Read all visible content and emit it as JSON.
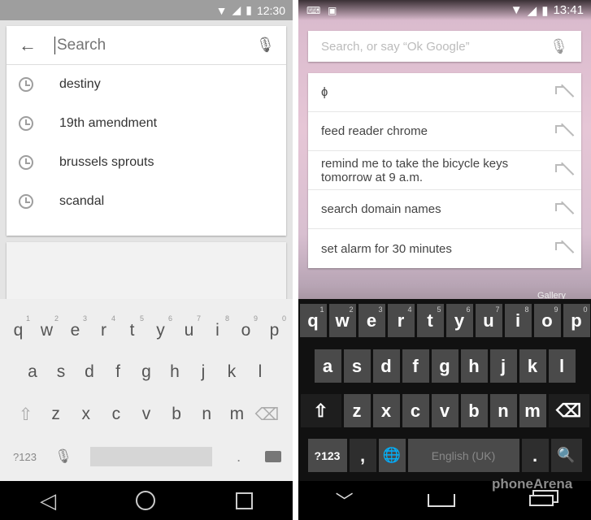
{
  "left": {
    "status_time": "12:30",
    "search_placeholder": "Search",
    "history": [
      "destiny",
      "19th amendment",
      "brussels sprouts",
      "scandal"
    ],
    "keyboard": {
      "row1": [
        "q",
        "w",
        "e",
        "r",
        "t",
        "y",
        "u",
        "i",
        "o",
        "p"
      ],
      "row1_hints": [
        "1",
        "2",
        "3",
        "4",
        "5",
        "6",
        "7",
        "8",
        "9",
        "0"
      ],
      "row2": [
        "a",
        "s",
        "d",
        "f",
        "g",
        "h",
        "j",
        "k",
        "l"
      ],
      "row3": [
        "z",
        "x",
        "c",
        "v",
        "b",
        "n",
        "m"
      ],
      "symbols": "?123",
      "period": "."
    }
  },
  "right": {
    "status_time": "13:41",
    "search_placeholder": "Search, or say “Ok Google”",
    "suggestions": [
      "ɸ",
      "feed reader chrome",
      "remind me to take the bicycle keys tomorrow at 9 a.m.",
      "search domain names",
      "set alarm for 30 minutes"
    ],
    "gallery_label": "Gallery",
    "keyboard": {
      "row1": [
        "q",
        "w",
        "e",
        "r",
        "t",
        "y",
        "u",
        "i",
        "o",
        "p"
      ],
      "row1_hints": [
        "1",
        "2",
        "3",
        "4",
        "5",
        "6",
        "7",
        "8",
        "9",
        "0"
      ],
      "row2": [
        "a",
        "s",
        "d",
        "f",
        "g",
        "h",
        "j",
        "k",
        "l"
      ],
      "row3": [
        "z",
        "x",
        "c",
        "v",
        "b",
        "n",
        "m"
      ],
      "symbols": "?123",
      "comma": ",",
      "space": "English (UK)",
      "period": "."
    },
    "watermark": "phoneArena"
  }
}
